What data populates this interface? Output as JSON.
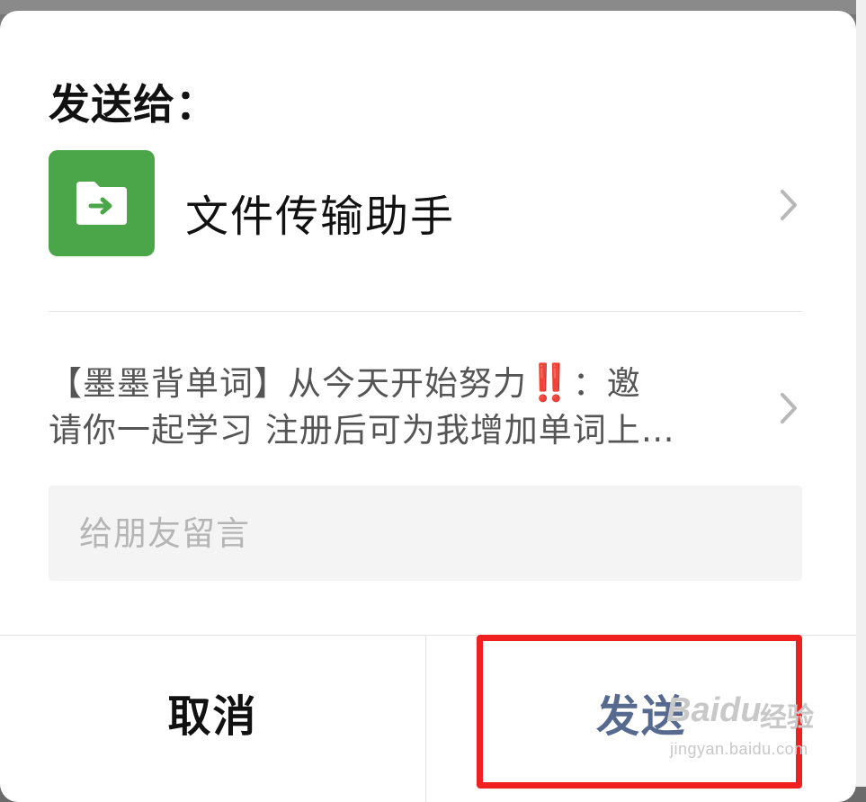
{
  "dialog": {
    "title": "发送给：",
    "recipient": {
      "name": "文件传输助手",
      "icon": "folder-arrow-icon",
      "icon_color": "#4aa649"
    },
    "shared_item": {
      "line1": "【墨墨背单词】从今天开始努力",
      "emphasis": "‼️",
      "line1_suffix": "：邀",
      "line2": "请你一起学习 注册后可为我增加单词上…"
    },
    "message": {
      "placeholder": "给朋友留言",
      "value": ""
    },
    "buttons": {
      "cancel_label": "取消",
      "send_label": "发送",
      "send_color": "#56698f"
    }
  },
  "watermark": {
    "logo": "Baidu",
    "label": "经验",
    "url": "jingyan.baidu.com"
  },
  "highlight_color": "#f02020"
}
